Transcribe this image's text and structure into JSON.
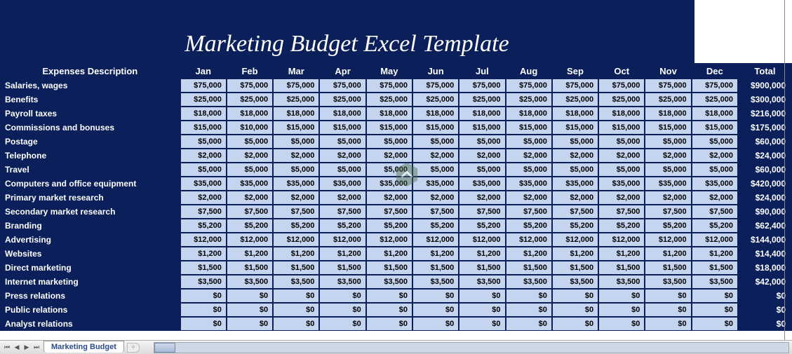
{
  "title": "Marketing Budget Excel Template",
  "tab_name": "Marketing Budget",
  "headers": {
    "desc": "Expenses Description",
    "months": [
      "Jan",
      "Feb",
      "Mar",
      "Apr",
      "May",
      "Jun",
      "Jul",
      "Aug",
      "Sep",
      "Oct",
      "Nov",
      "Dec"
    ],
    "total": "Total"
  },
  "rows": [
    {
      "desc": "Salaries, wages",
      "vals": [
        "$75,000",
        "$75,000",
        "$75,000",
        "$75,000",
        "$75,000",
        "$75,000",
        "$75,000",
        "$75,000",
        "$75,000",
        "$75,000",
        "$75,000",
        "$75,000"
      ],
      "total": "$900,000"
    },
    {
      "desc": "Benefits",
      "vals": [
        "$25,000",
        "$25,000",
        "$25,000",
        "$25,000",
        "$25,000",
        "$25,000",
        "$25,000",
        "$25,000",
        "$25,000",
        "$25,000",
        "$25,000",
        "$25,000"
      ],
      "total": "$300,000"
    },
    {
      "desc": "Payroll taxes",
      "vals": [
        "$18,000",
        "$18,000",
        "$18,000",
        "$18,000",
        "$18,000",
        "$18,000",
        "$18,000",
        "$18,000",
        "$18,000",
        "$18,000",
        "$18,000",
        "$18,000"
      ],
      "total": "$216,000"
    },
    {
      "desc": "Commissions and bonuses",
      "vals": [
        "$15,000",
        "$10,000",
        "$15,000",
        "$15,000",
        "$15,000",
        "$15,000",
        "$15,000",
        "$15,000",
        "$15,000",
        "$15,000",
        "$15,000",
        "$15,000"
      ],
      "total": "$175,000"
    },
    {
      "desc": "Postage",
      "vals": [
        "$5,000",
        "$5,000",
        "$5,000",
        "$5,000",
        "$5,000",
        "$5,000",
        "$5,000",
        "$5,000",
        "$5,000",
        "$5,000",
        "$5,000",
        "$5,000"
      ],
      "total": "$60,000"
    },
    {
      "desc": "Telephone",
      "vals": [
        "$2,000",
        "$2,000",
        "$2,000",
        "$2,000",
        "$2,000",
        "$2,000",
        "$2,000",
        "$2,000",
        "$2,000",
        "$2,000",
        "$2,000",
        "$2,000"
      ],
      "total": "$24,000"
    },
    {
      "desc": "Travel",
      "vals": [
        "$5,000",
        "$5,000",
        "$5,000",
        "$5,000",
        "$5,000",
        "$5,000",
        "$5,000",
        "$5,000",
        "$5,000",
        "$5,000",
        "$5,000",
        "$5,000"
      ],
      "total": "$60,000"
    },
    {
      "desc": "Computers and office equipment",
      "vals": [
        "$35,000",
        "$35,000",
        "$35,000",
        "$35,000",
        "$35,000",
        "$35,000",
        "$35,000",
        "$35,000",
        "$35,000",
        "$35,000",
        "$35,000",
        "$35,000"
      ],
      "total": "$420,000"
    },
    {
      "desc": "Primary market research",
      "vals": [
        "$2,000",
        "$2,000",
        "$2,000",
        "$2,000",
        "$2,000",
        "$2,000",
        "$2,000",
        "$2,000",
        "$2,000",
        "$2,000",
        "$2,000",
        "$2,000"
      ],
      "total": "$24,000"
    },
    {
      "desc": "Secondary market research",
      "vals": [
        "$7,500",
        "$7,500",
        "$7,500",
        "$7,500",
        "$7,500",
        "$7,500",
        "$7,500",
        "$7,500",
        "$7,500",
        "$7,500",
        "$7,500",
        "$7,500"
      ],
      "total": "$90,000"
    },
    {
      "desc": "Branding",
      "vals": [
        "$5,200",
        "$5,200",
        "$5,200",
        "$5,200",
        "$5,200",
        "$5,200",
        "$5,200",
        "$5,200",
        "$5,200",
        "$5,200",
        "$5,200",
        "$5,200"
      ],
      "total": "$62,400"
    },
    {
      "desc": "Advertising",
      "vals": [
        "$12,000",
        "$12,000",
        "$12,000",
        "$12,000",
        "$12,000",
        "$12,000",
        "$12,000",
        "$12,000",
        "$12,000",
        "$12,000",
        "$12,000",
        "$12,000"
      ],
      "total": "$144,000"
    },
    {
      "desc": "Websites",
      "vals": [
        "$1,200",
        "$1,200",
        "$1,200",
        "$1,200",
        "$1,200",
        "$1,200",
        "$1,200",
        "$1,200",
        "$1,200",
        "$1,200",
        "$1,200",
        "$1,200"
      ],
      "total": "$14,400"
    },
    {
      "desc": "Direct marketing",
      "vals": [
        "$1,500",
        "$1,500",
        "$1,500",
        "$1,500",
        "$1,500",
        "$1,500",
        "$1,500",
        "$1,500",
        "$1,500",
        "$1,500",
        "$1,500",
        "$1,500"
      ],
      "total": "$18,000"
    },
    {
      "desc": "Internet marketing",
      "vals": [
        "$3,500",
        "$3,500",
        "$3,500",
        "$3,500",
        "$3,500",
        "$3,500",
        "$3,500",
        "$3,500",
        "$3,500",
        "$3,500",
        "$3,500",
        "$3,500"
      ],
      "total": "$42,000"
    },
    {
      "desc": "Press relations",
      "vals": [
        "$0",
        "$0",
        "$0",
        "$0",
        "$0",
        "$0",
        "$0",
        "$0",
        "$0",
        "$0",
        "$0",
        "$0"
      ],
      "total": "$0"
    },
    {
      "desc": "Public relations",
      "vals": [
        "$0",
        "$0",
        "$0",
        "$0",
        "$0",
        "$0",
        "$0",
        "$0",
        "$0",
        "$0",
        "$0",
        "$0"
      ],
      "total": "$0"
    },
    {
      "desc": "Analyst relations",
      "vals": [
        "$0",
        "$0",
        "$0",
        "$0",
        "$0",
        "$0",
        "$0",
        "$0",
        "$0",
        "$0",
        "$0",
        "$0"
      ],
      "total": "$0"
    }
  ],
  "chart_data": {
    "type": "table",
    "title": "Marketing Budget Excel Template",
    "columns": [
      "Expenses Description",
      "Jan",
      "Feb",
      "Mar",
      "Apr",
      "May",
      "Jun",
      "Jul",
      "Aug",
      "Sep",
      "Oct",
      "Nov",
      "Dec",
      "Total"
    ],
    "rows": [
      [
        "Salaries, wages",
        75000,
        75000,
        75000,
        75000,
        75000,
        75000,
        75000,
        75000,
        75000,
        75000,
        75000,
        75000,
        900000
      ],
      [
        "Benefits",
        25000,
        25000,
        25000,
        25000,
        25000,
        25000,
        25000,
        25000,
        25000,
        25000,
        25000,
        25000,
        300000
      ],
      [
        "Payroll taxes",
        18000,
        18000,
        18000,
        18000,
        18000,
        18000,
        18000,
        18000,
        18000,
        18000,
        18000,
        18000,
        216000
      ],
      [
        "Commissions and bonuses",
        15000,
        10000,
        15000,
        15000,
        15000,
        15000,
        15000,
        15000,
        15000,
        15000,
        15000,
        15000,
        175000
      ],
      [
        "Postage",
        5000,
        5000,
        5000,
        5000,
        5000,
        5000,
        5000,
        5000,
        5000,
        5000,
        5000,
        5000,
        60000
      ],
      [
        "Telephone",
        2000,
        2000,
        2000,
        2000,
        2000,
        2000,
        2000,
        2000,
        2000,
        2000,
        2000,
        2000,
        24000
      ],
      [
        "Travel",
        5000,
        5000,
        5000,
        5000,
        5000,
        5000,
        5000,
        5000,
        5000,
        5000,
        5000,
        5000,
        60000
      ],
      [
        "Computers and office equipment",
        35000,
        35000,
        35000,
        35000,
        35000,
        35000,
        35000,
        35000,
        35000,
        35000,
        35000,
        35000,
        420000
      ],
      [
        "Primary market research",
        2000,
        2000,
        2000,
        2000,
        2000,
        2000,
        2000,
        2000,
        2000,
        2000,
        2000,
        2000,
        24000
      ],
      [
        "Secondary market research",
        7500,
        7500,
        7500,
        7500,
        7500,
        7500,
        7500,
        7500,
        7500,
        7500,
        7500,
        7500,
        90000
      ],
      [
        "Branding",
        5200,
        5200,
        5200,
        5200,
        5200,
        5200,
        5200,
        5200,
        5200,
        5200,
        5200,
        5200,
        62400
      ],
      [
        "Advertising",
        12000,
        12000,
        12000,
        12000,
        12000,
        12000,
        12000,
        12000,
        12000,
        12000,
        12000,
        12000,
        144000
      ],
      [
        "Websites",
        1200,
        1200,
        1200,
        1200,
        1200,
        1200,
        1200,
        1200,
        1200,
        1200,
        1200,
        1200,
        14400
      ],
      [
        "Direct marketing",
        1500,
        1500,
        1500,
        1500,
        1500,
        1500,
        1500,
        1500,
        1500,
        1500,
        1500,
        1500,
        18000
      ],
      [
        "Internet marketing",
        3500,
        3500,
        3500,
        3500,
        3500,
        3500,
        3500,
        3500,
        3500,
        3500,
        3500,
        3500,
        42000
      ],
      [
        "Press relations",
        0,
        0,
        0,
        0,
        0,
        0,
        0,
        0,
        0,
        0,
        0,
        0,
        0
      ],
      [
        "Public relations",
        0,
        0,
        0,
        0,
        0,
        0,
        0,
        0,
        0,
        0,
        0,
        0,
        0
      ],
      [
        "Analyst relations",
        0,
        0,
        0,
        0,
        0,
        0,
        0,
        0,
        0,
        0,
        0,
        0,
        0
      ]
    ]
  }
}
